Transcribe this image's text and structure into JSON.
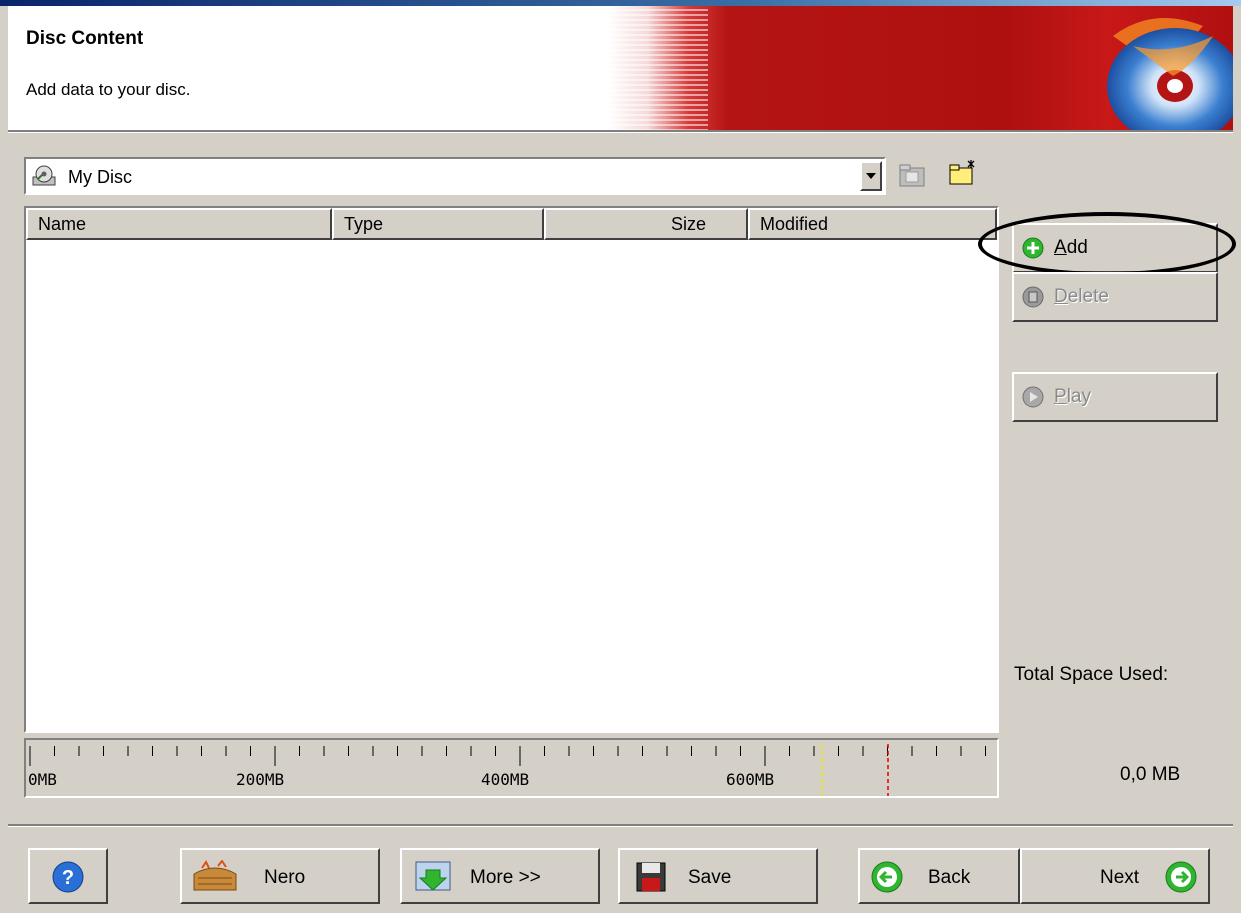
{
  "header": {
    "title": "Disc Content",
    "subtitle": "Add data to your disc."
  },
  "path_combo": {
    "value": "My Disc",
    "icons": [
      "disc-icon",
      "dropdown-arrow-icon",
      "folder-up-icon",
      "new-folder-icon"
    ]
  },
  "list": {
    "columns": [
      "Name",
      "Type",
      "Size",
      "Modified"
    ],
    "rows": []
  },
  "capacity": {
    "labels": [
      "0MB",
      "200MB",
      "400MB",
      "600MB"
    ],
    "used_mb": 0,
    "markers": {
      "yellow": "#e8e800",
      "red": "#e00000"
    }
  },
  "side_buttons": {
    "add": {
      "label_first": "A",
      "label_rest": "dd",
      "enabled": true
    },
    "delete": {
      "label_first": "D",
      "label_rest": "elete",
      "enabled": false
    },
    "play": {
      "label_first": "P",
      "label_rest": "lay",
      "enabled": false
    }
  },
  "space": {
    "label": "Total Space Used:",
    "value": "0,0 MB"
  },
  "footer": {
    "help_icon": "help-icon",
    "nero": "Nero",
    "more": "More >>",
    "save": "Save",
    "back": "Back",
    "next": "Next"
  },
  "colors": {
    "header_red": "#b41414",
    "face": "#d4d0c8",
    "add_green": "#2fb52f"
  }
}
